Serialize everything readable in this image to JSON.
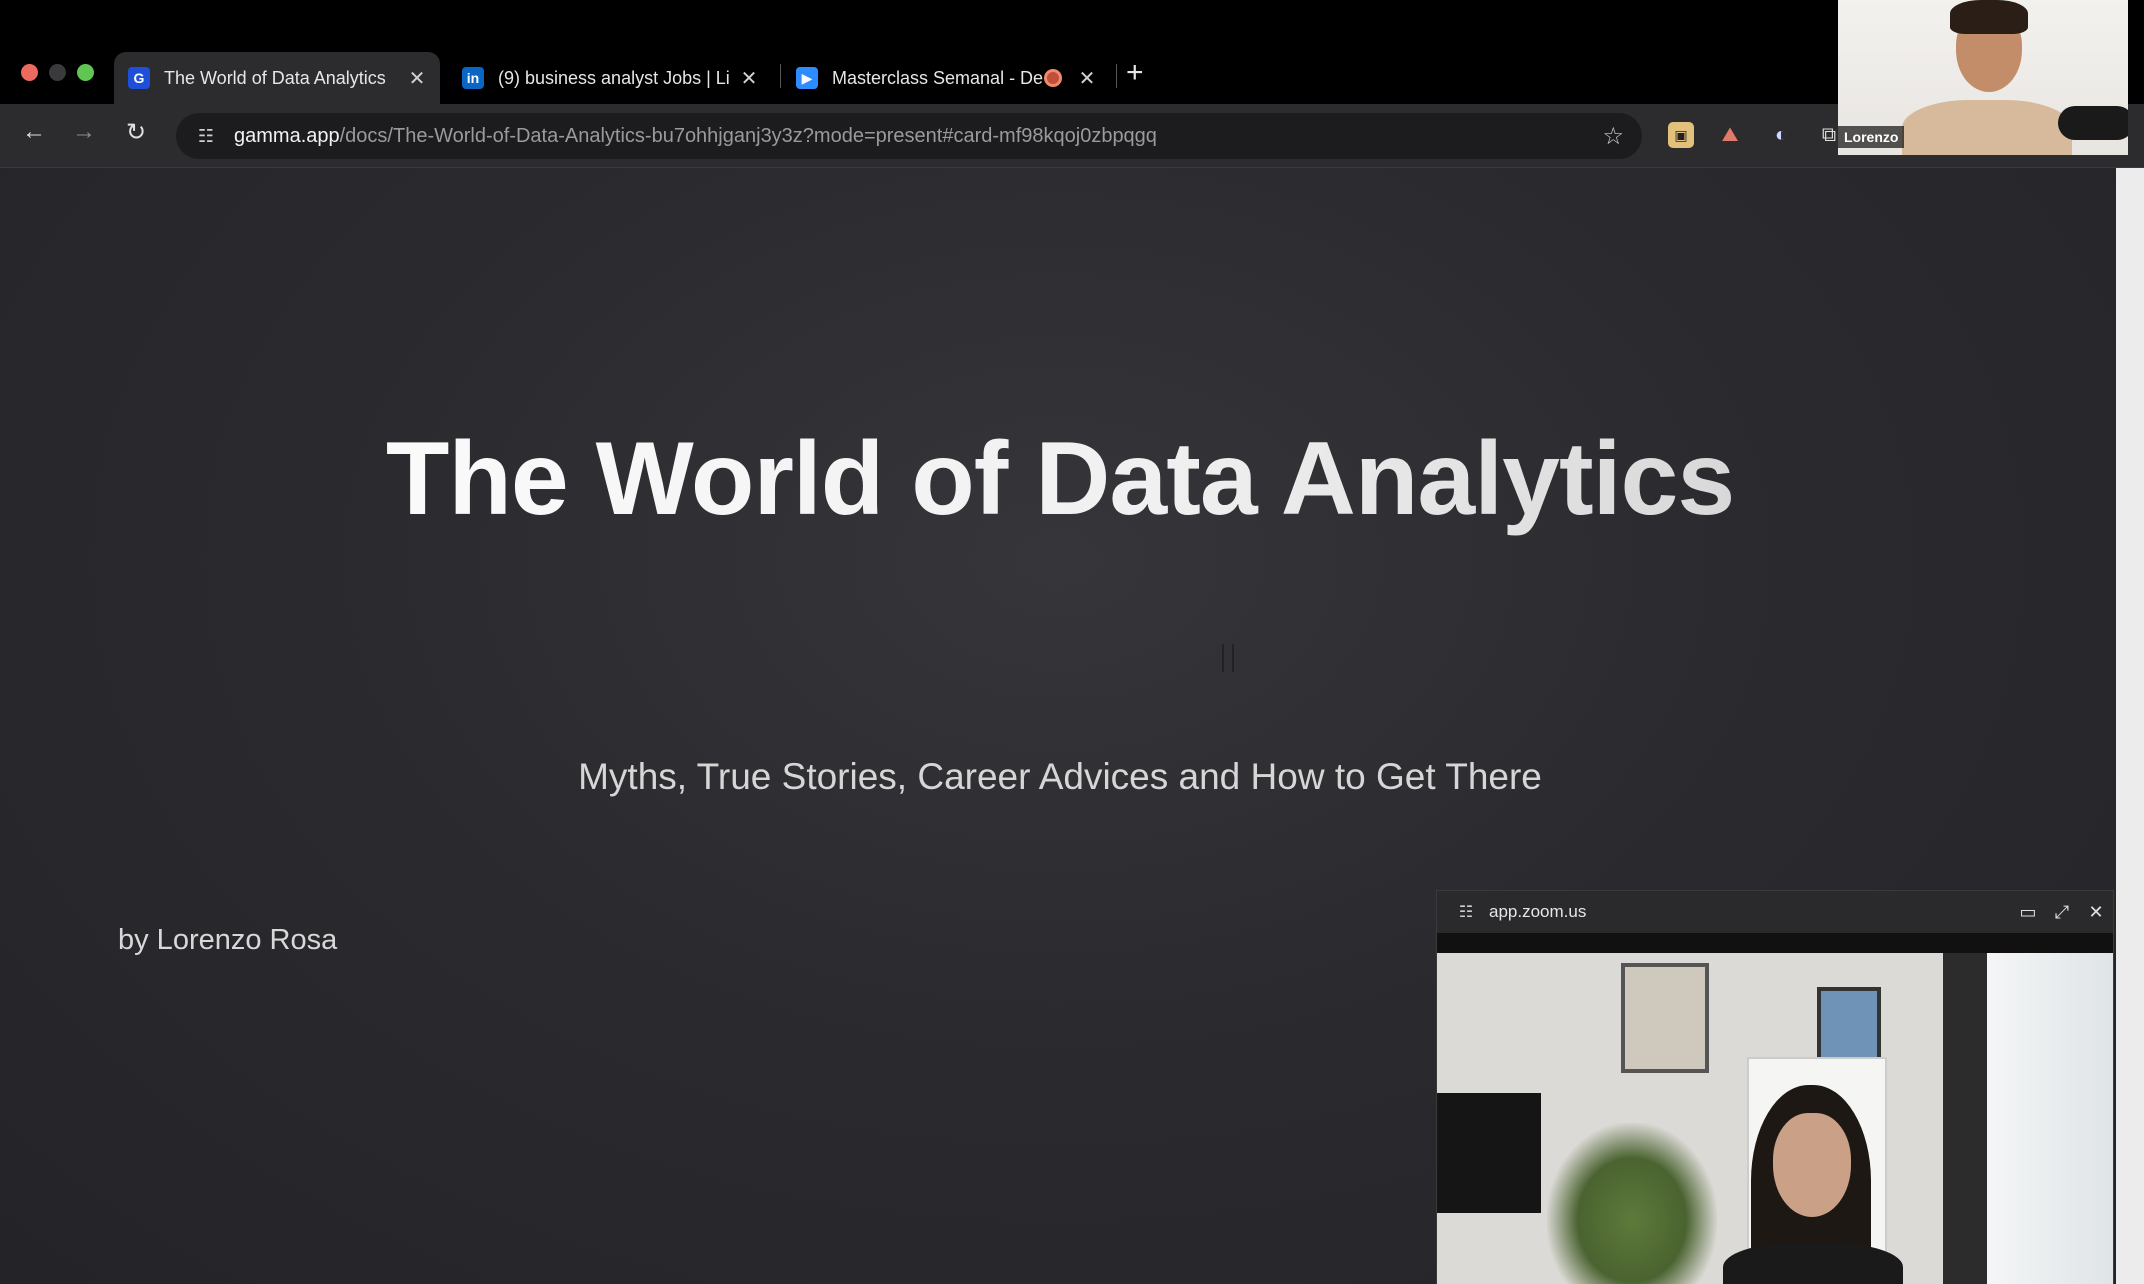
{
  "browser": {
    "tabs": [
      {
        "label": "The World of Data Analytics",
        "icon": "gamma-favicon-icon",
        "active": true
      },
      {
        "label": "(9) business analyst Jobs | Li",
        "icon": "linkedin-favicon-icon",
        "active": false
      },
      {
        "label": "Masterclass Semanal - De",
        "icon": "zoom-favicon-icon",
        "active": false
      }
    ],
    "new_tab_symbol": "+",
    "address": {
      "host": "gamma.app",
      "path": "/docs/The-World-of-Data-Analytics-bu7ohhjganj3y3z?mode=present#card-mf98kqoj0zbpqgq"
    }
  },
  "slide": {
    "title": "The World of Data Analytics",
    "subtitle": "Myths, True Stories, Career Advices and How to Get There",
    "author": "by Lorenzo Rosa"
  },
  "self_view": {
    "name": "Lorenzo"
  },
  "zoom_popup": {
    "host": "app.zoom.us"
  },
  "colors": {
    "accent_red": "#ed6a5e",
    "accent_green": "#61c554",
    "linkedin_blue": "#0a66c2",
    "zoom_blue": "#2d8cff"
  }
}
